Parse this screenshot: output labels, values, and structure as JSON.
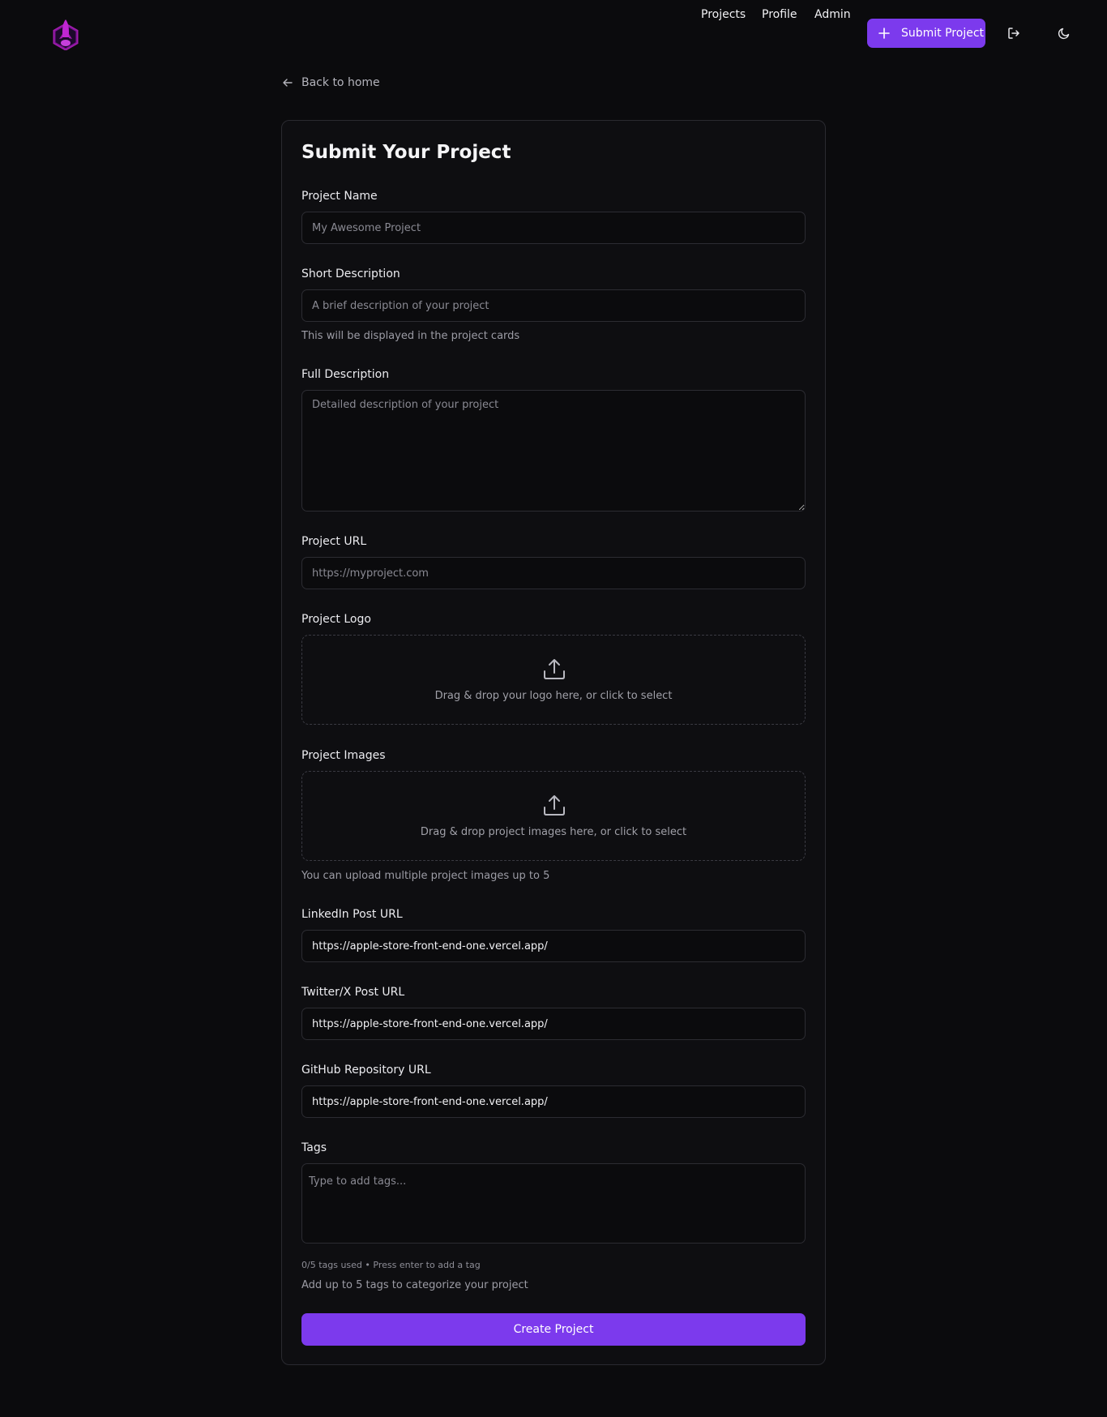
{
  "nav": {
    "links": [
      "Projects",
      "Profile",
      "Admin"
    ],
    "submit_label": "Submit Project",
    "icons": [
      "logout-icon",
      "moon-icon"
    ]
  },
  "back_label": "Back to home",
  "form": {
    "title": "Submit Your Project",
    "project_name": {
      "label": "Project Name",
      "placeholder": "My Awesome Project",
      "value": ""
    },
    "short_description": {
      "label": "Short Description",
      "placeholder": "A brief description of your project",
      "help": "This will be displayed in the project cards"
    },
    "full_description": {
      "label": "Full Description",
      "placeholder": "Detailed description of your project"
    },
    "project_url": {
      "label": "Project URL",
      "placeholder": "https://myproject.com"
    },
    "project_logo": {
      "label": "Project Logo",
      "dropzone_text": "Drag & drop your logo here, or click to select"
    },
    "project_images": {
      "label": "Project Images",
      "dropzone_text": "Drag & drop project images here, or click to select",
      "help": "You can upload multiple project images up to 5"
    },
    "linkedin_url": {
      "label": "LinkedIn Post URL",
      "value": "https://apple-store-front-end-one.vercel.app/"
    },
    "twitter_url": {
      "label": "Twitter/X Post URL",
      "value": "https://apple-store-front-end-one.vercel.app/"
    },
    "github_url": {
      "label": "GitHub Repository URL",
      "value": "https://apple-store-front-end-one.vercel.app/"
    },
    "tags": {
      "label": "Tags",
      "placeholder": "Type to add tags...",
      "counter": "0/5 tags used • Press enter to add a tag",
      "help": "Add up to 5 tags to categorize your project"
    },
    "create_label": "Create Project"
  },
  "colors": {
    "accent": "#7c3aed",
    "background": "#0b0b0d",
    "border": "#2c2c32"
  }
}
